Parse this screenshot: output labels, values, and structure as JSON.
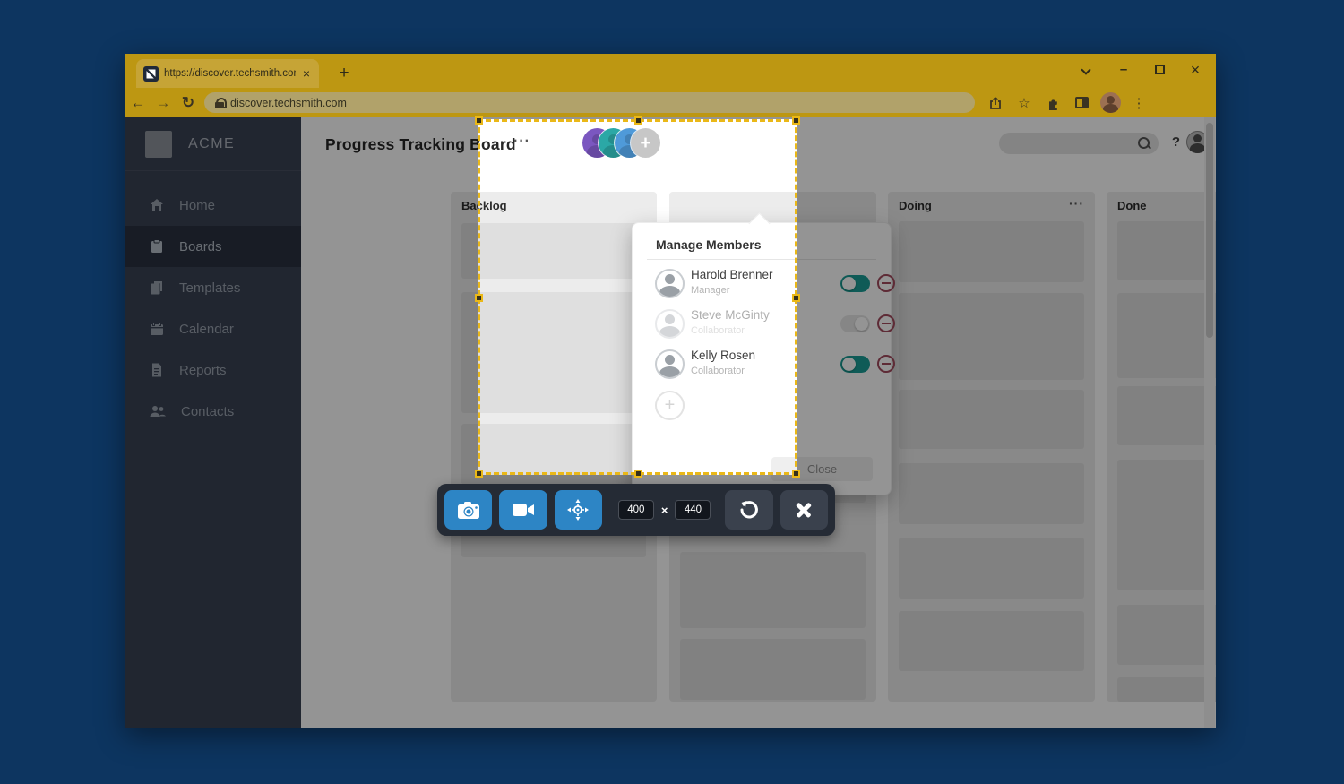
{
  "browser": {
    "tab": {
      "title": "https://discover.techsmith.com",
      "close": "×",
      "new_tab": "+"
    },
    "window_controls": {
      "minimize": "–",
      "close": "×"
    },
    "address": {
      "url": "discover.techsmith.com"
    },
    "nav": {
      "back": "←",
      "forward": "→",
      "reload": "↻",
      "star": "☆",
      "kebab": "⋮"
    }
  },
  "sidebar": {
    "brand": "ACME",
    "items": [
      {
        "label": "Home"
      },
      {
        "label": "Boards"
      },
      {
        "label": "Templates"
      },
      {
        "label": "Calendar"
      },
      {
        "label": "Reports"
      },
      {
        "label": "Contacts"
      }
    ]
  },
  "header": {
    "title": "Progress Tracking Board",
    "menu_dots": "···",
    "avatar_plus": "+",
    "help": "?"
  },
  "board": {
    "columns": [
      {
        "label": "Backlog",
        "dots": ""
      },
      {
        "label": "",
        "dots": ""
      },
      {
        "label": "Doing",
        "dots": "···"
      },
      {
        "label": "Done",
        "dots": "···"
      }
    ]
  },
  "popup": {
    "title": "Manage Members",
    "members": [
      {
        "name": "Harold Brenner",
        "role": "Manager",
        "toggle": "on"
      },
      {
        "name": "Steve McGinty",
        "role": "Collaborator",
        "toggle": "off"
      },
      {
        "name": "Kelly Rosen",
        "role": "Collaborator",
        "toggle": "on"
      }
    ],
    "add_label": "+",
    "close_label": "Close"
  },
  "capture": {
    "width_value": "400",
    "separator": "×",
    "height_value": "440"
  },
  "colors": {
    "desktop_navy": "#0d3560",
    "chrome_gold": "#bd9712",
    "selection_gold": "#eab818",
    "snagit_blue": "#2d85c5",
    "toggle_teal": "#1a9e96",
    "remove_red": "#a34a5e",
    "sidebar_slate": "#3a4254"
  }
}
